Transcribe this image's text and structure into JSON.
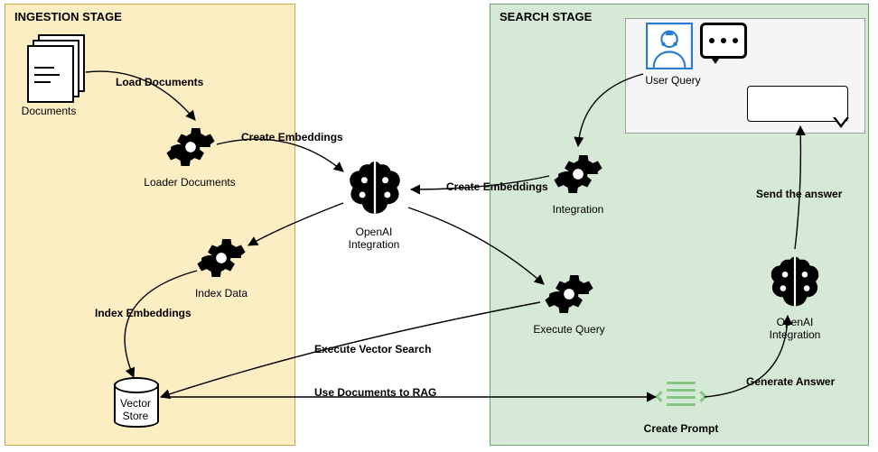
{
  "stages": {
    "ingestion_title": "INGESTION STAGE",
    "search_title": "SEARCH STAGE"
  },
  "nodes": {
    "documents": "Documents",
    "loader_documents": "Loader Documents",
    "openai_integration_center": "OpenAI\nIntegration",
    "index_data": "Index Data",
    "vector_store": "Vector\nStore",
    "user_query": "User Query",
    "integration": "Integration",
    "execute_query": "Execute Query",
    "create_prompt": "Create Prompt",
    "openai_integration_right": "OpenAI\nIntegration"
  },
  "edges": {
    "load_documents": "Load Documents",
    "create_embeddings_left": "Create Embeddings",
    "create_embeddings_right": "Create Embeddings",
    "index_embeddings": "Index Embeddings",
    "execute_vector_search": "Execute Vector Search",
    "use_documents_to_rag": "Use Documents to RAG",
    "generate_answer": "Generate Answer",
    "send_the_answer": "Send the answer"
  }
}
